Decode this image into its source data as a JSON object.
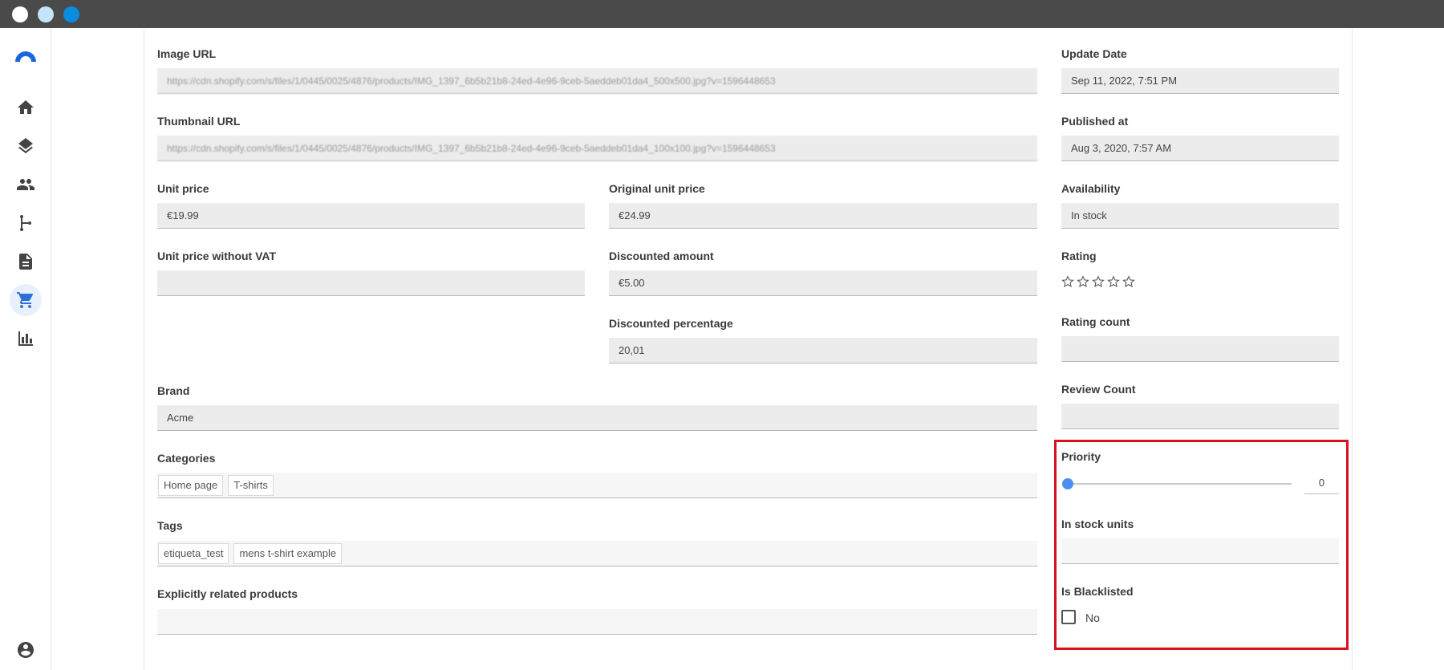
{
  "window": {
    "controls": [
      "close",
      "minimize",
      "maximize"
    ]
  },
  "nav": {
    "items": [
      {
        "name": "home-icon"
      },
      {
        "name": "layers-icon"
      },
      {
        "name": "people-icon"
      },
      {
        "name": "branch-icon"
      },
      {
        "name": "document-icon"
      },
      {
        "name": "cart-icon",
        "active": true
      },
      {
        "name": "bar-chart-icon"
      }
    ],
    "account_icon": "account-circle-icon"
  },
  "fields": {
    "image_url": {
      "label": "Image URL",
      "value": "https://cdn.shopify.com/s/files/1/0445/0025/4876/products/IMG_1397_6b5b21b8-24ed-4e96-9ceb-5aeddeb01da4_500x500.jpg?v=1596448653"
    },
    "thumbnail_url": {
      "label": "Thumbnail URL",
      "value": "https://cdn.shopify.com/s/files/1/0445/0025/4876/products/IMG_1397_6b5b21b8-24ed-4e96-9ceb-5aeddeb01da4_100x100.jpg?v=1596448653"
    },
    "update_date": {
      "label": "Update Date",
      "value": "Sep 11, 2022, 7:51 PM"
    },
    "published_at": {
      "label": "Published at",
      "value": "Aug 3, 2020, 7:57 AM"
    },
    "unit_price": {
      "label": "Unit price",
      "value": "€19.99"
    },
    "original_unit_price": {
      "label": "Original unit price",
      "value": "€24.99"
    },
    "availability": {
      "label": "Availability",
      "value": "In stock"
    },
    "unit_price_without_vat": {
      "label": "Unit price without VAT",
      "value": ""
    },
    "discounted_amount": {
      "label": "Discounted amount",
      "value": "€5.00"
    },
    "rating": {
      "label": "Rating",
      "stars": 0,
      "max": 5
    },
    "discounted_percentage": {
      "label": "Discounted percentage",
      "value": "20,01"
    },
    "rating_count": {
      "label": "Rating count",
      "value": ""
    },
    "brand": {
      "label": "Brand",
      "value": "Acme"
    },
    "review_count": {
      "label": "Review Count",
      "value": ""
    },
    "categories": {
      "label": "Categories",
      "chips": [
        "Home page",
        "T-shirts"
      ]
    },
    "priority": {
      "label": "Priority",
      "value": "0",
      "slider_fraction": 0
    },
    "tags": {
      "label": "Tags",
      "chips": [
        "etiqueta_test",
        "mens t-shirt example"
      ]
    },
    "in_stock_units": {
      "label": "In stock units",
      "value": ""
    },
    "explicitly_related_products": {
      "label": "Explicitly related products",
      "value": ""
    },
    "is_blacklisted": {
      "label": "Is Blacklisted",
      "checked": false,
      "text": "No"
    }
  },
  "colors": {
    "accent": "#4d8ff0",
    "highlight": "#d8121d"
  }
}
